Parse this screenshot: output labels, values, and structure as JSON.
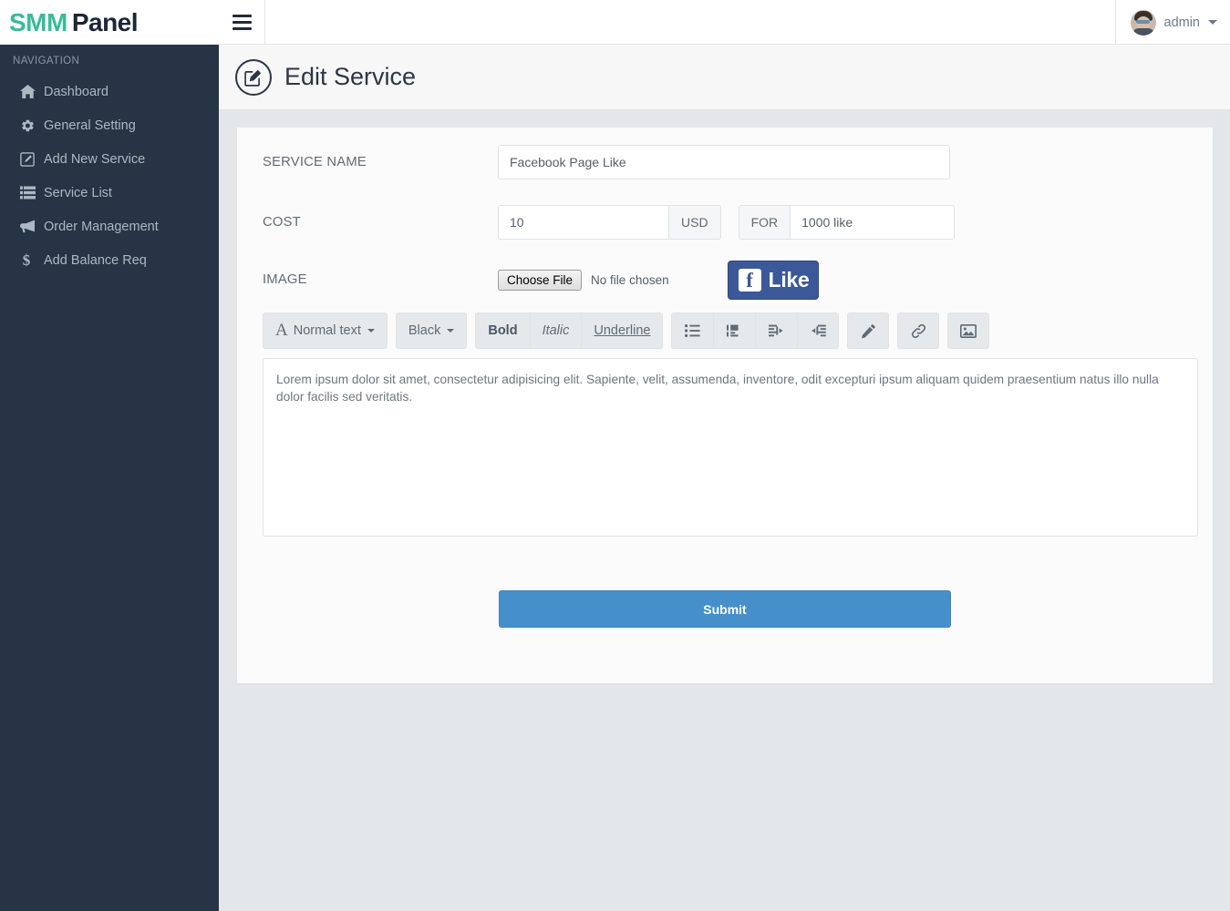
{
  "brand": {
    "first": "SMM",
    "second": "Panel"
  },
  "sidebar": {
    "nav_title": "NAVIGATION",
    "items": [
      {
        "label": "Dashboard",
        "icon": "home-icon"
      },
      {
        "label": "General Setting",
        "icon": "gear-icon"
      },
      {
        "label": "Add New Service",
        "icon": "pen-square-icon"
      },
      {
        "label": "Service List",
        "icon": "server-list-icon"
      },
      {
        "label": "Order Management",
        "icon": "bullhorn-icon"
      },
      {
        "label": "Add Balance Req",
        "icon": "dollar-sign-icon"
      }
    ]
  },
  "topbar": {
    "menu_icon": "hamburger-icon",
    "user_name": "admin",
    "caret_icon": "caret-down-icon"
  },
  "page": {
    "icon": "edit-pencil-circle-icon",
    "title": "Edit Service"
  },
  "form": {
    "service_name": {
      "label": "SERVICE NAME",
      "value": "Facebook Page Like",
      "placeholder": "Service Name"
    },
    "cost": {
      "label": "COST",
      "value": "10",
      "placeholder": "Cost",
      "currency": "USD",
      "for_label": "FOR",
      "quantity": "1000 like",
      "quantity_placeholder": "Quantity"
    },
    "image": {
      "label": "IMAGE",
      "choose_file": "Choose File",
      "no_file": "No file chosen",
      "preview_alt": "facebook-like-image",
      "preview_f": "f",
      "preview_text": "Like"
    },
    "editor": {
      "toolbar": [
        {
          "label": "Normal text",
          "name": "text-style-dropdown",
          "type": "dropdown",
          "icon": "font-size-a-icon"
        },
        {
          "label": "Black",
          "name": "text-color-dropdown",
          "type": "dropdown"
        },
        {
          "label": "Bold",
          "name": "bold-button",
          "type": "bold"
        },
        {
          "label": "Italic",
          "name": "italic-button",
          "type": "italic"
        },
        {
          "label": "Underline",
          "name": "underline-button",
          "type": "underline"
        },
        {
          "label": "",
          "name": "unordered-list-button",
          "type": "icon",
          "icon": "unordered-list-icon"
        },
        {
          "label": "",
          "name": "ordered-list-button",
          "type": "icon",
          "icon": "block-list-icon"
        },
        {
          "label": "",
          "name": "indent-button",
          "type": "icon",
          "icon": "indent-right-icon"
        },
        {
          "label": "",
          "name": "outdent-button",
          "type": "icon",
          "icon": "outdent-left-icon"
        },
        {
          "label": "",
          "name": "pencil-button",
          "type": "icon",
          "icon": "pencil-icon"
        },
        {
          "label": "",
          "name": "link-button",
          "type": "icon",
          "icon": "link-chain-icon"
        },
        {
          "label": "",
          "name": "insert-image-button",
          "type": "icon",
          "icon": "image-icon"
        }
      ],
      "content": "Lorem ipsum dolor sit amet, consectetur adipisicing elit. Sapiente, velit, assumenda, inventore, odit excepturi ipsum aliquam quidem praesentium natus illo nulla dolor facilis sed veritatis."
    },
    "submit_label": "Submit"
  },
  "colors": {
    "brand_accent": "#37bc9b",
    "sidebar_bg": "#263445",
    "page_bg": "#e4e7ea",
    "submit_blue": "#4590cb",
    "facebook_blue": "#3b5998"
  }
}
